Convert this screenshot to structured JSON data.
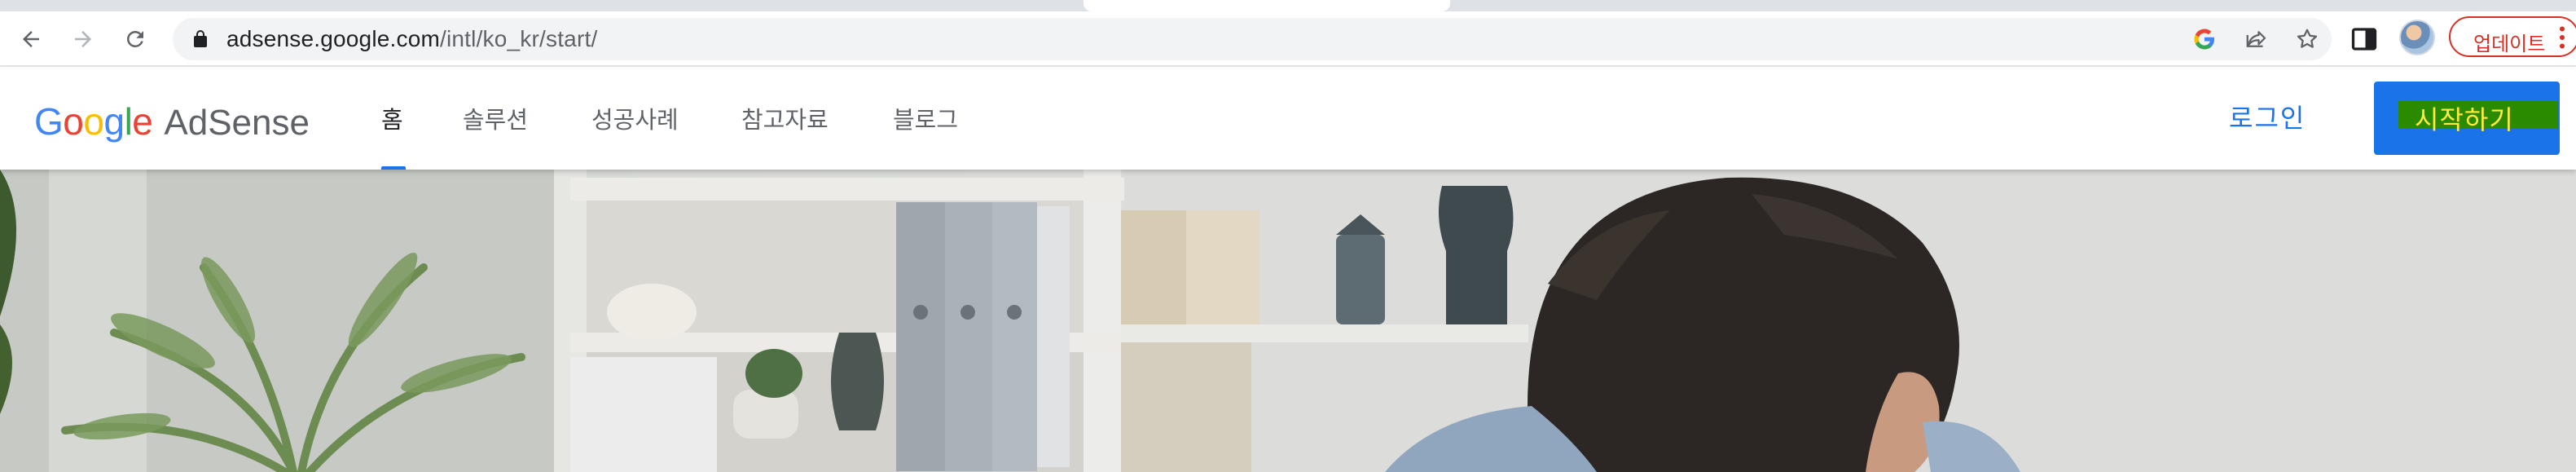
{
  "browser": {
    "url_host": "adsense.google.com",
    "url_path": "/intl/ko_kr/start/",
    "update_label": "업데이트"
  },
  "site": {
    "logo_google": "Google",
    "logo_product": "AdSense",
    "nav": [
      {
        "label": "홈",
        "active": true
      },
      {
        "label": "솔루션",
        "active": false
      },
      {
        "label": "성공사례",
        "active": false
      },
      {
        "label": "참고자료",
        "active": false
      },
      {
        "label": "블로그",
        "active": false
      }
    ],
    "login_label": "로그인",
    "start_label": "시작하기"
  },
  "colors": {
    "accent": "#1a73e8",
    "start_text": "#ffeb3b",
    "update_red": "#d93025"
  },
  "icons": [
    "back-arrow-icon",
    "forward-arrow-icon",
    "reload-icon",
    "lock-icon",
    "google-icon",
    "share-icon",
    "bookmark-star-icon",
    "side-panel-icon",
    "profile-avatar",
    "kebab-menu-icon"
  ]
}
